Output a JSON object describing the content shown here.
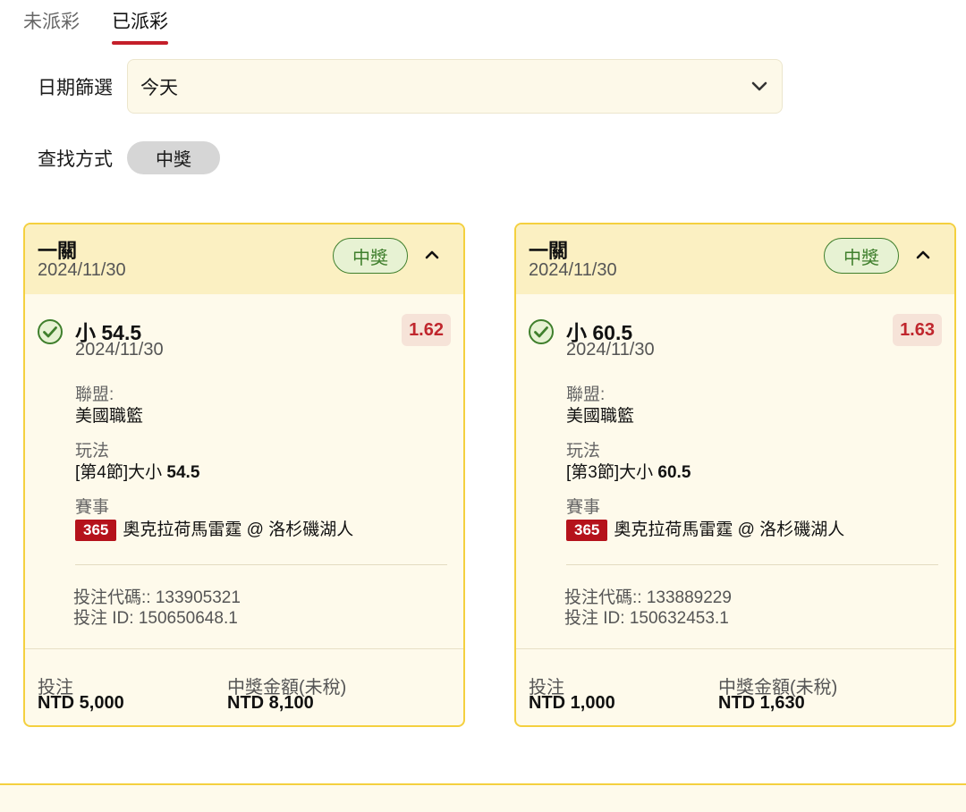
{
  "tabs": [
    {
      "label": "未派彩",
      "active": false
    },
    {
      "label": "已派彩",
      "active": true
    }
  ],
  "date_filter": {
    "label": "日期篩選",
    "value": "今天",
    "icon": "chevron-down-icon"
  },
  "search_mode": {
    "label": "查找方式",
    "chip": "中獎"
  },
  "cards": [
    {
      "title": "一關",
      "date": "2024/11/30",
      "badge": "中獎",
      "selection": "小 54.5",
      "selection_date": "2024/11/30",
      "odds": "1.62",
      "league_label": "聯盟:",
      "league": "美國職籃",
      "play_label": "玩法",
      "play_prefix": "[第4節]大小 ",
      "play_line": "54.5",
      "event_label": "賽事",
      "event_tag": "365",
      "event": "奧克拉荷馬雷霆 @ 洛杉磯湖人",
      "bet_code": "投注代碼:: 133905321",
      "bet_id": "投注 ID: 150650648.1",
      "stake_label": "投注",
      "stake": "NTD 5,000",
      "payout_label": "中獎金額(未稅)",
      "payout": "NTD 8,100"
    },
    {
      "title": "一關",
      "date": "2024/11/30",
      "badge": "中獎",
      "selection": "小 60.5",
      "selection_date": "2024/11/30",
      "odds": "1.63",
      "league_label": "聯盟:",
      "league": "美國職籃",
      "play_label": "玩法",
      "play_prefix": "[第3節]大小 ",
      "play_line": "60.5",
      "event_label": "賽事",
      "event_tag": "365",
      "event": "奧克拉荷馬雷霆 @ 洛杉磯湖人",
      "bet_code": "投注代碼:: 133889229",
      "bet_id": "投注 ID: 150632453.1",
      "stake_label": "投注",
      "stake": "NTD 1,000",
      "payout_label": "中獎金額(未稅)",
      "payout": "NTD 1,630"
    }
  ],
  "colors": {
    "accent_red": "#c41f2a",
    "card_border": "#f4d03f",
    "win_green": "#3f7f2c",
    "card_bg": "#fefaeb",
    "header_bg": "#fbf0c2"
  }
}
